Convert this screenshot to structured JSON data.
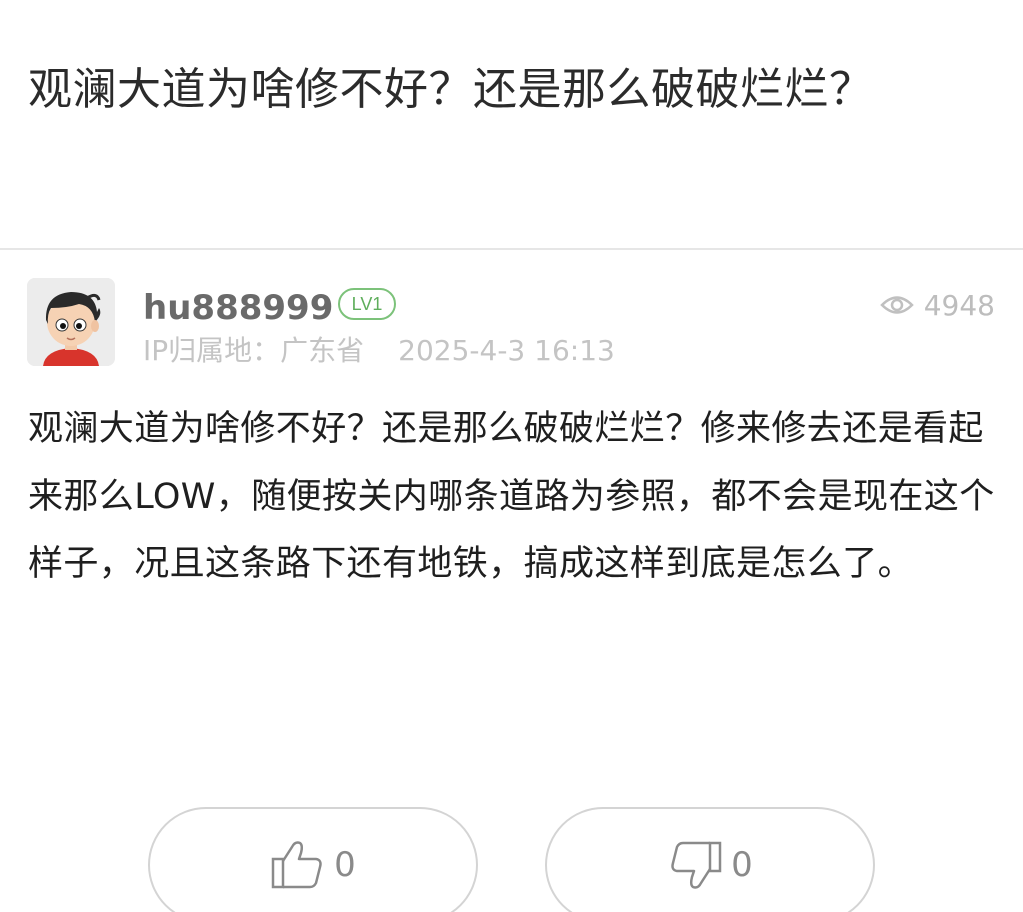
{
  "post": {
    "title": "观澜大道为啥修不好？还是那么破破烂烂？",
    "author": {
      "username": "hu888999",
      "level": "LV1",
      "ip_location": "IP归属地：广东省",
      "date": "2025-4-3 16:13",
      "avatar_icon": "cartoon-avatar"
    },
    "views": "4948",
    "content": "观澜大道为啥修不好？还是那么破破烂烂？修来修去还是看起来那么LOW，随便按关内哪条道路为参照，都不会是现在这个样子，况且这条路下还有地铁，搞成这样到底是怎么了。"
  },
  "actions": {
    "like_count": "0",
    "dislike_count": "0",
    "like_icon": "thumbs-up-icon",
    "dislike_icon": "thumbs-down-icon"
  },
  "colors": {
    "level_badge": "#7cc27a",
    "text_primary": "#1f1f1f",
    "text_muted": "#c4c4c4",
    "divider": "#e6e6e6"
  }
}
